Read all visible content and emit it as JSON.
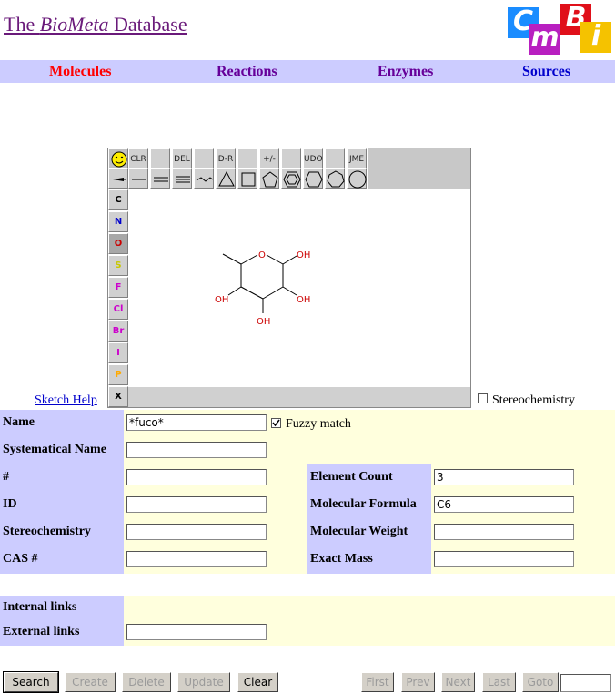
{
  "header": {
    "title_pre": "The ",
    "title_italic": "BioMeta",
    "title_post": " Database",
    "logo_letters": [
      "C",
      "m",
      "B",
      "i"
    ]
  },
  "nav": {
    "molecules": "Molecules",
    "reactions": "Reactions",
    "enzymes": "Enzymes",
    "sources": "Sources",
    "active_color": "#ff0000",
    "link_color": "#660099",
    "sources_color": "#0000cc"
  },
  "editor": {
    "toolbar_labels": {
      "clr": "CLR",
      "del": "DEL",
      "dr": "D-R",
      "pm": "+/-",
      "udo": "UDO",
      "jme": "JME"
    },
    "atoms": [
      {
        "symbol": "C",
        "color": "#000000"
      },
      {
        "symbol": "N",
        "color": "#0000cc"
      },
      {
        "symbol": "O",
        "color": "#cc0000"
      },
      {
        "symbol": "S",
        "color": "#c8c800"
      },
      {
        "symbol": "F",
        "color": "#cc00cc"
      },
      {
        "symbol": "Cl",
        "color": "#cc00cc"
      },
      {
        "symbol": "Br",
        "color": "#cc00cc"
      },
      {
        "symbol": "I",
        "color": "#cc00cc"
      },
      {
        "symbol": "P",
        "color": "#ffaa00"
      },
      {
        "symbol": "X",
        "color": "#000000"
      }
    ],
    "molecule": {
      "ring_o": "O",
      "oh": "OH"
    }
  },
  "sketch_help": "Sketch Help",
  "stereo_checkbox": {
    "label": "Stereochemistry",
    "checked": false
  },
  "form": {
    "name": {
      "label": "Name",
      "value": "*fuco*"
    },
    "fuzzy": {
      "label": "Fuzzy match",
      "checked": true
    },
    "systematical_name": {
      "label": "Systematical Name",
      "value": ""
    },
    "number": {
      "label": "#",
      "value": ""
    },
    "id": {
      "label": "ID",
      "value": ""
    },
    "stereochemistry": {
      "label": "Stereochemistry",
      "value": ""
    },
    "cas": {
      "label": "CAS #",
      "value": ""
    },
    "element_count": {
      "label": "Element Count",
      "value": "3"
    },
    "molecular_formula": {
      "label": "Molecular Formula",
      "value": "C6"
    },
    "molecular_weight": {
      "label": "Molecular Weight",
      "value": ""
    },
    "exact_mass": {
      "label": "Exact Mass",
      "value": ""
    },
    "internal_links": {
      "label": "Internal links"
    },
    "external_links": {
      "label": "External links",
      "value": ""
    }
  },
  "buttons": {
    "search": "Search",
    "create": "Create",
    "delete": "Delete",
    "update": "Update",
    "clear": "Clear",
    "first": "First",
    "prev": "Prev",
    "next": "Next",
    "last": "Last",
    "goto": "Goto",
    "goto_value": ""
  }
}
